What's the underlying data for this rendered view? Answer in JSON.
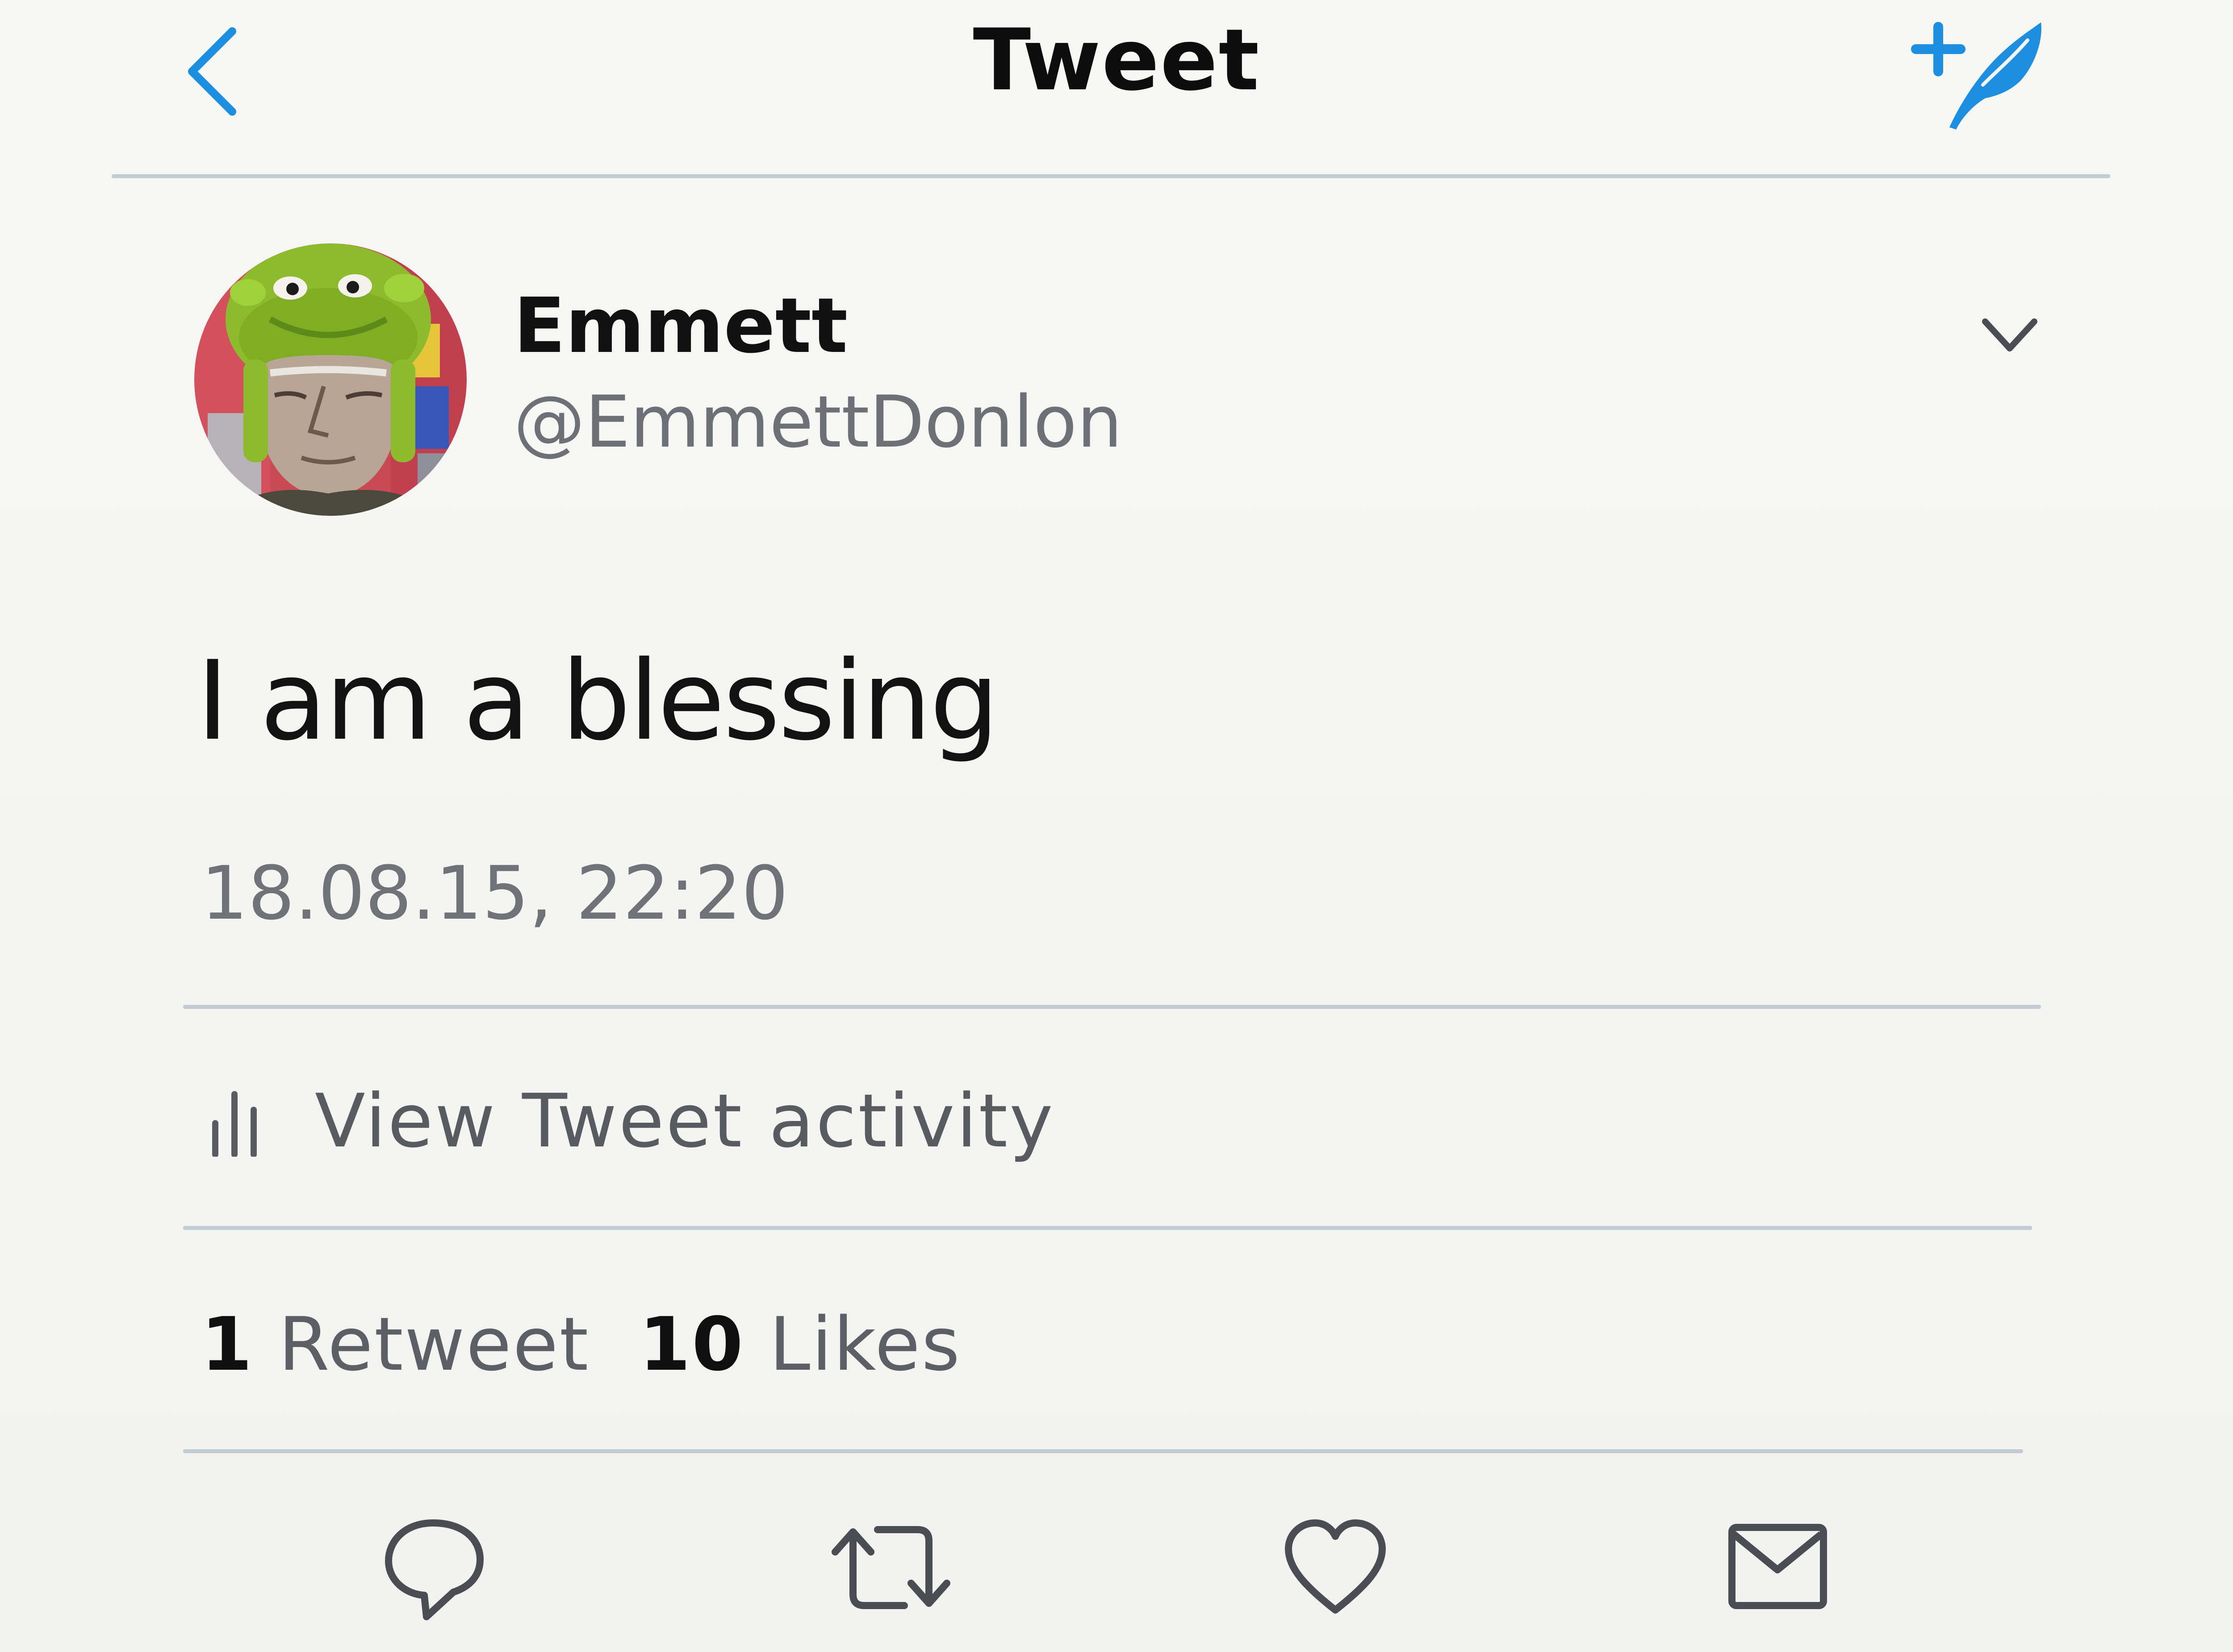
{
  "header": {
    "title": "Tweet",
    "back_icon": "chevron-left-icon",
    "compose_icon": "compose-tweet-icon",
    "accent_color": "#1d8fe0"
  },
  "tweet": {
    "author": {
      "display_name": "Emmett",
      "handle": "@EmmettDonlon"
    },
    "menu_icon": "chevron-down-icon",
    "text": "I am a blessing",
    "timestamp": "18.08.15, 22:20",
    "activity": {
      "icon": "bar-chart-icon",
      "label": "View Tweet activity"
    },
    "stats": {
      "retweets_count": "1",
      "retweets_label": "Retweet",
      "likes_count": "10",
      "likes_label": "Likes"
    },
    "actions": [
      {
        "name": "reply",
        "icon": "reply-icon"
      },
      {
        "name": "retweet",
        "icon": "retweet-icon"
      },
      {
        "name": "like",
        "icon": "heart-icon"
      },
      {
        "name": "share",
        "icon": "envelope-icon"
      }
    ]
  },
  "colors": {
    "text_primary": "#121212",
    "text_secondary": "#6f7378",
    "divider": "#c4ccd3",
    "icon_gray": "#4a4e54"
  }
}
